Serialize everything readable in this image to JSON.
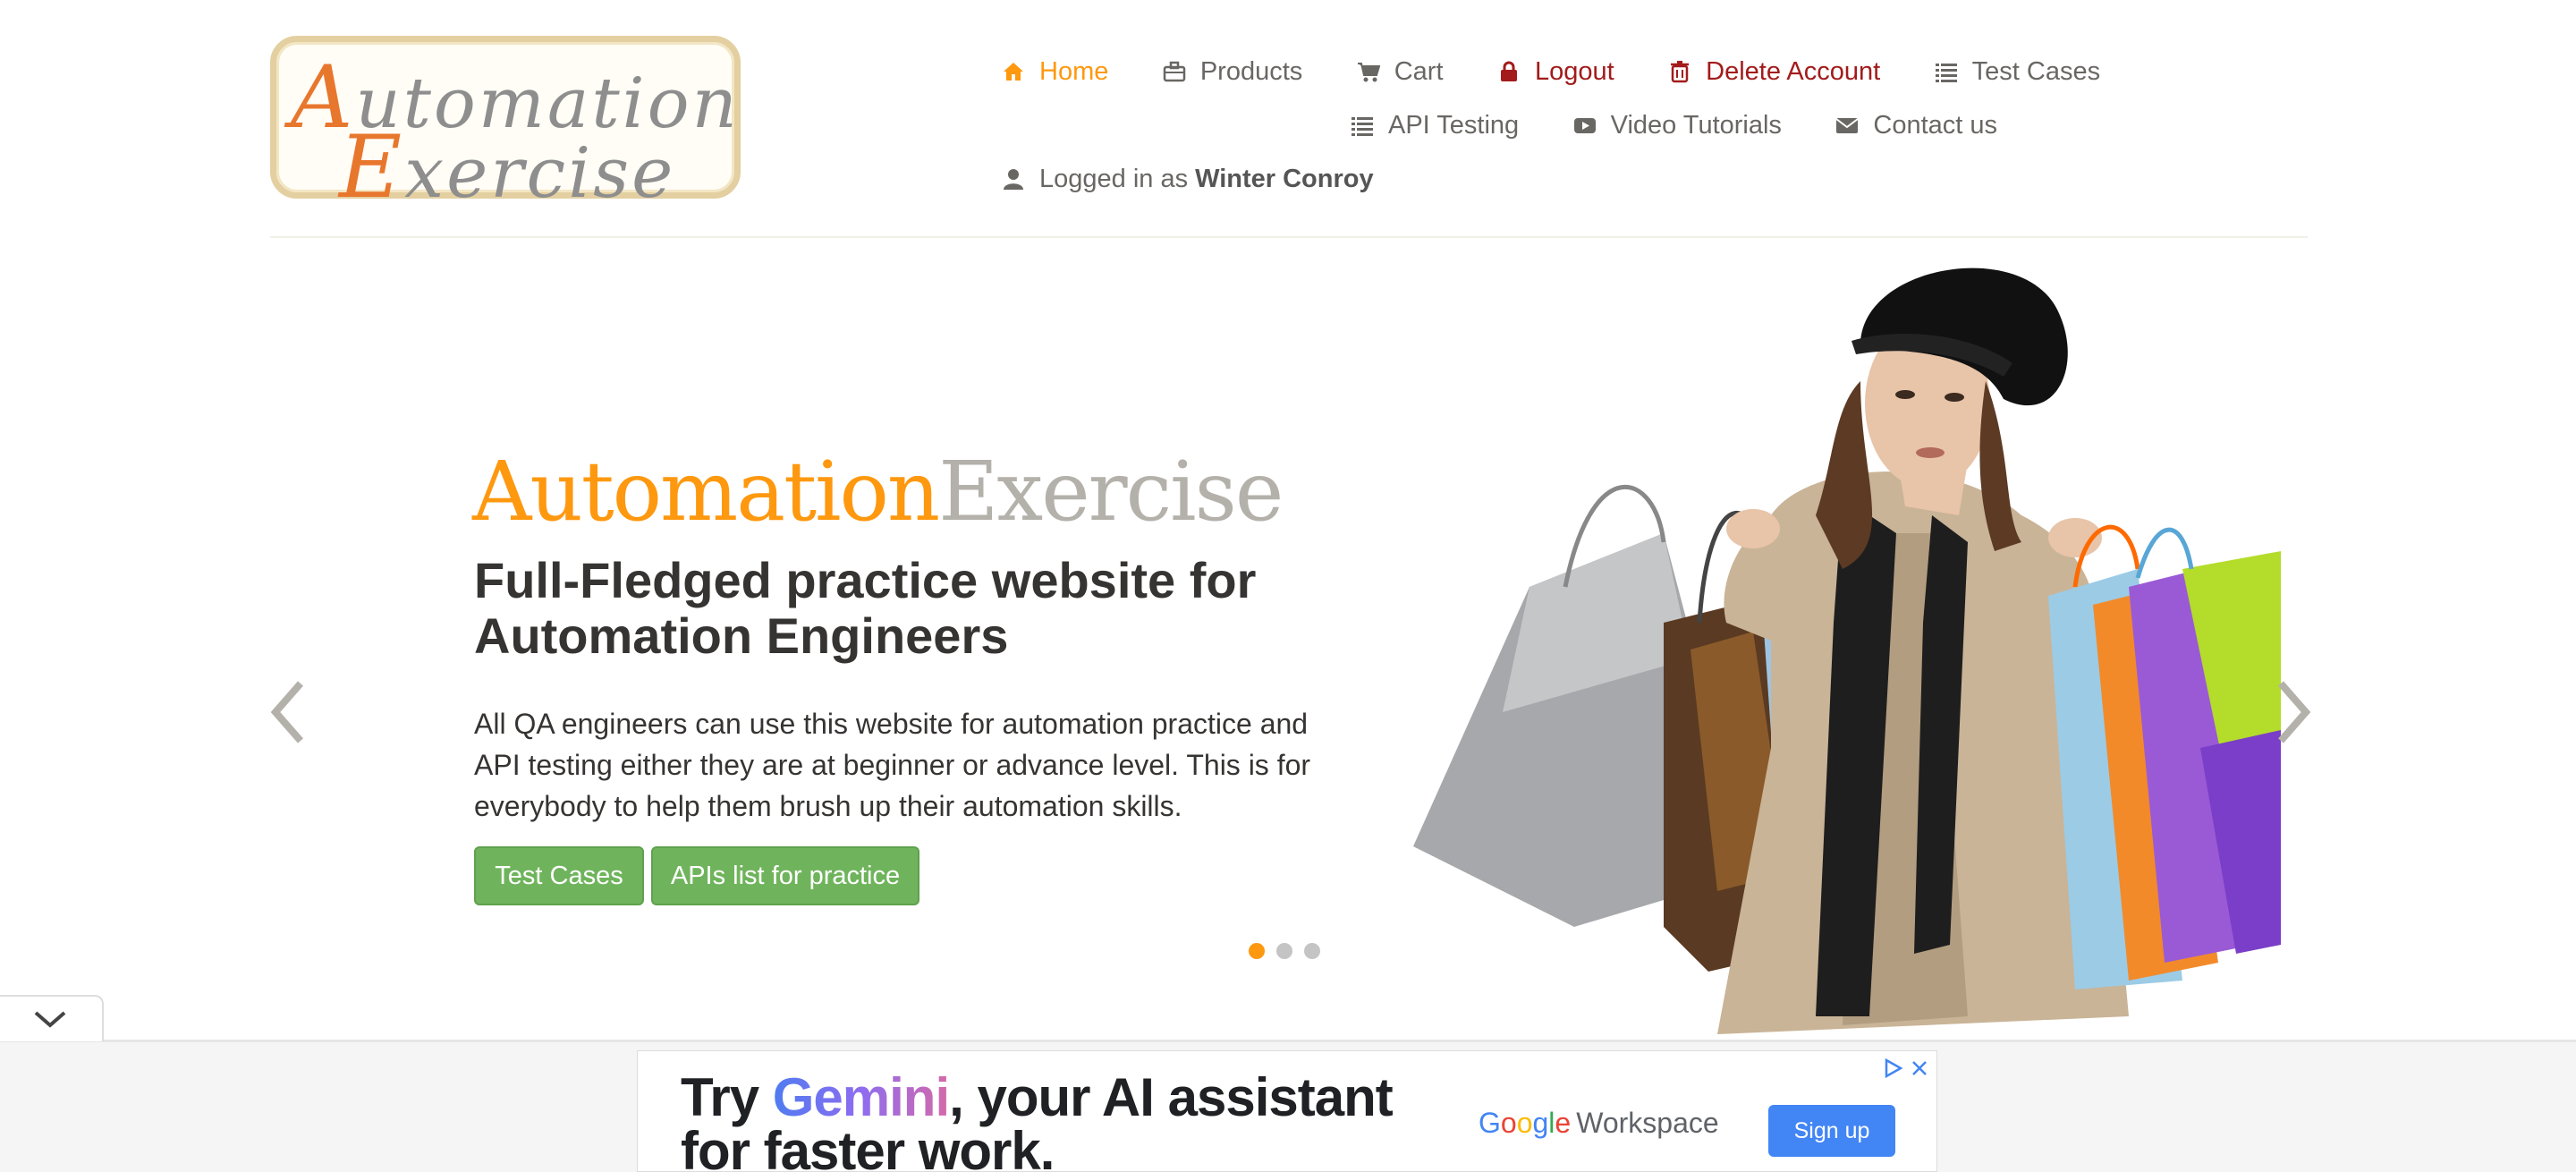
{
  "logo": {
    "line1_cap": "A",
    "line1_rest": "utomation",
    "line2_cap": "E",
    "line2_rest": "xercise"
  },
  "nav": {
    "home": {
      "label": "Home",
      "icon": "home-icon"
    },
    "products": {
      "label": "Products",
      "icon": "briefcase-icon"
    },
    "cart": {
      "label": "Cart",
      "icon": "cart-icon"
    },
    "logout": {
      "label": "Logout",
      "icon": "lock-icon"
    },
    "delete_account": {
      "label": "Delete Account",
      "icon": "trash-icon"
    },
    "test_cases": {
      "label": "Test Cases",
      "icon": "list-icon"
    },
    "api_testing": {
      "label": "API Testing",
      "icon": "list-icon"
    },
    "video_tutorials": {
      "label": "Video Tutorials",
      "icon": "youtube-icon"
    },
    "contact_us": {
      "label": "Contact us",
      "icon": "envelope-icon"
    },
    "logged_in_prefix": "Logged in as",
    "logged_in_user": "Winter Conroy"
  },
  "hero": {
    "brand_part1": "Automation",
    "brand_part2": "Exercise",
    "title": "Full-Fledged practice website for Automation Engineers",
    "description": "All QA engineers can use this website for automation practice and API testing either they are at beginner or advance level. This is for everybody to help them brush up their automation skills.",
    "button_test_cases": "Test Cases",
    "button_apis": "APIs list for practice",
    "active_slide": 1,
    "slide_count": 3
  },
  "ad": {
    "text_try": "Try ",
    "text_gemini": "Gemini",
    "text_rest": ", your AI assistant for faster work.",
    "google_letters": [
      "G",
      "o",
      "o",
      "g",
      "l",
      "e"
    ],
    "workspace": "Workspace",
    "signup": "Sign up"
  },
  "colors": {
    "accent": "#fe980f",
    "danger": "#a31b1b",
    "button_green": "#6fb45c",
    "ad_blue": "#4285f4"
  }
}
